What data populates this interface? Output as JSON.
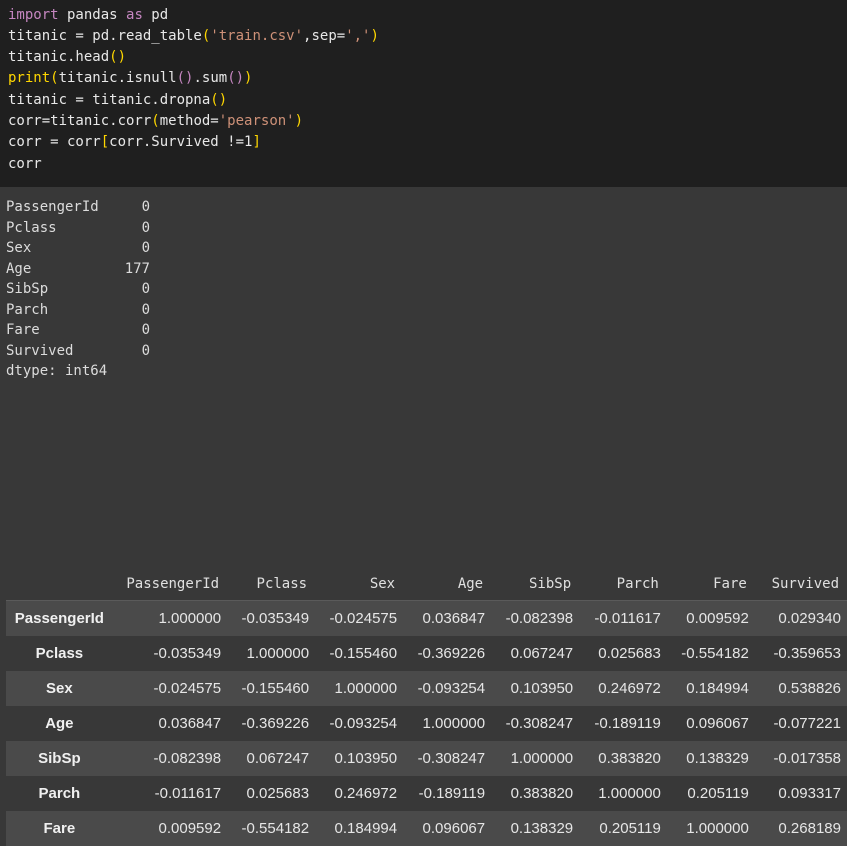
{
  "code": {
    "lines": [
      [
        "import",
        " pandas ",
        "as",
        " pd"
      ],
      [
        "titanic = pd.read_table",
        "(",
        "'train.csv'",
        ",sep=",
        "','",
        ")"
      ],
      [
        "titanic.head",
        "()",
        ""
      ],
      [
        "print",
        "(",
        "titanic.isnull",
        "()",
        ".sum",
        "()",
        ")"
      ],
      [
        "titanic = titanic.dropna",
        "()",
        ""
      ],
      [
        "corr=titanic.corr",
        "(",
        "method=",
        "'pearson'",
        ")"
      ],
      [
        "corr = corr",
        "[",
        "corr.Survived !=1",
        "]"
      ],
      [
        "corr"
      ]
    ]
  },
  "null_counts": {
    "rows": [
      {
        "name": "PassengerId",
        "value": "0"
      },
      {
        "name": "Pclass",
        "value": "0"
      },
      {
        "name": "Sex",
        "value": "0"
      },
      {
        "name": "Age",
        "value": "177"
      },
      {
        "name": "SibSp",
        "value": "0"
      },
      {
        "name": "Parch",
        "value": "0"
      },
      {
        "name": "Fare",
        "value": "0"
      },
      {
        "name": "Survived",
        "value": "0"
      }
    ],
    "dtype": "dtype: int64"
  },
  "corr_table": {
    "columns": [
      "PassengerId",
      "Pclass",
      "Sex",
      "Age",
      "SibSp",
      "Parch",
      "Fare",
      "Survived"
    ],
    "rows": [
      {
        "index": "PassengerId",
        "values": [
          "1.000000",
          "-0.035349",
          "-0.024575",
          "0.036847",
          "-0.082398",
          "-0.011617",
          "0.009592",
          "0.029340"
        ]
      },
      {
        "index": "Pclass",
        "values": [
          "-0.035349",
          "1.000000",
          "-0.155460",
          "-0.369226",
          "0.067247",
          "0.025683",
          "-0.554182",
          "-0.359653"
        ]
      },
      {
        "index": "Sex",
        "values": [
          "-0.024575",
          "-0.155460",
          "1.000000",
          "-0.093254",
          "0.103950",
          "0.246972",
          "0.184994",
          "0.538826"
        ]
      },
      {
        "index": "Age",
        "values": [
          "0.036847",
          "-0.369226",
          "-0.093254",
          "1.000000",
          "-0.308247",
          "-0.189119",
          "0.096067",
          "-0.077221"
        ]
      },
      {
        "index": "SibSp",
        "values": [
          "-0.082398",
          "0.067247",
          "0.103950",
          "-0.308247",
          "1.000000",
          "0.383820",
          "0.138329",
          "-0.017358"
        ]
      },
      {
        "index": "Parch",
        "values": [
          "-0.011617",
          "0.025683",
          "0.246972",
          "-0.189119",
          "0.383820",
          "1.000000",
          "0.205119",
          "0.093317"
        ]
      },
      {
        "index": "Fare",
        "values": [
          "0.009592",
          "-0.554182",
          "0.184994",
          "0.096067",
          "0.138329",
          "0.205119",
          "1.000000",
          "0.268189"
        ]
      }
    ]
  }
}
